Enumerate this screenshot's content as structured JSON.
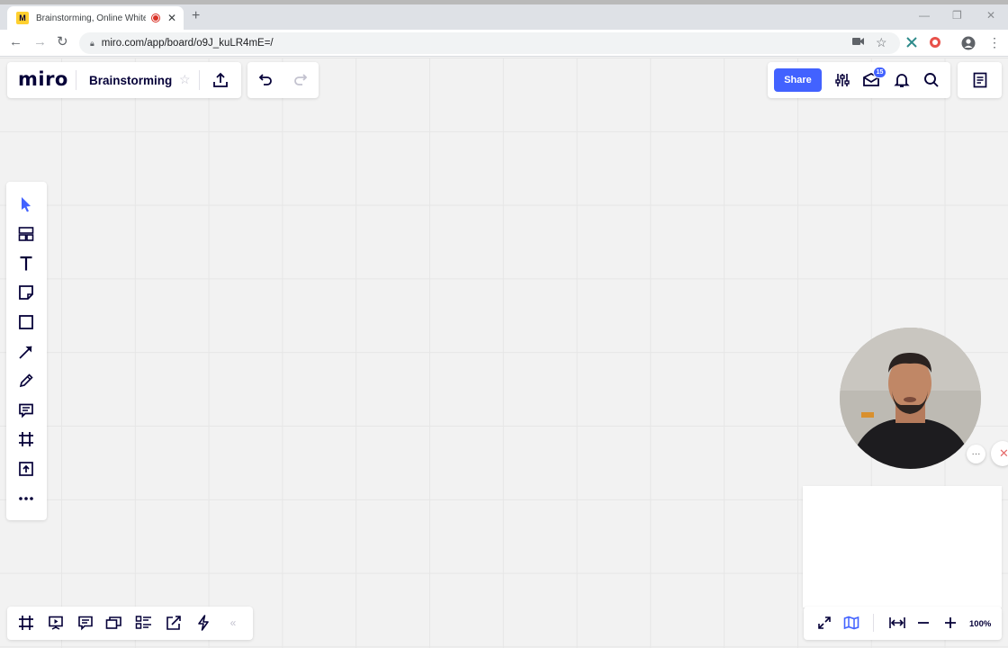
{
  "browser": {
    "tab_title": "Brainstorming, Online White",
    "favicon_letter": "M",
    "url": "miro.com/app/board/o9J_kuLR4mE=/",
    "icons": {
      "back": "back-arrow-icon",
      "forward": "forward-arrow-icon",
      "reload": "reload-icon",
      "lock": "lock-icon",
      "camera": "camera-icon",
      "bookmark": "star-icon",
      "extension": "extension-icon",
      "profile": "profile-icon",
      "menu": "menu-icon"
    }
  },
  "header": {
    "logo": "miro",
    "board_name": "Brainstorming",
    "share_label": "Share",
    "notification_badge": "15"
  },
  "left_tools": [
    "select-tool",
    "templates-tool",
    "text-tool",
    "sticky-note-tool",
    "shape-tool",
    "connection-line-tool",
    "pen-tool",
    "comment-tool",
    "frame-tool",
    "upload-tool",
    "more-tools"
  ],
  "bottom_tools": [
    "frames-panel",
    "presentation-mode",
    "comments-panel",
    "card-view",
    "activity-list",
    "export-board",
    "apps-power-ups",
    "collapse-toolbar"
  ],
  "zoom": {
    "level": "100%"
  },
  "colors": {
    "accent": "#4262ff",
    "ink": "#050038",
    "canvas": "#f2f2f2"
  }
}
